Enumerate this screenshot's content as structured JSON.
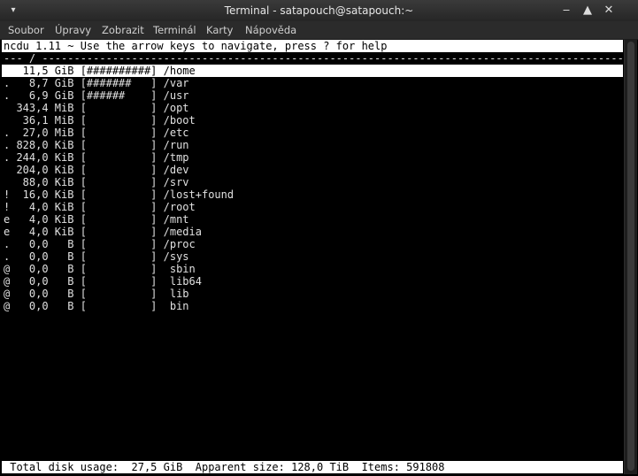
{
  "window": {
    "title": "Terminal - satapouch@satapouch:~",
    "menu_arrow": "▾",
    "minimize_glyph": "‒",
    "maximize_glyph": "▲",
    "close_glyph": "✕"
  },
  "menubar": {
    "items": [
      "Soubor",
      "Úpravy",
      "Zobrazit",
      "Terminál",
      "Karty",
      "Nápověda"
    ]
  },
  "terminal": {
    "header": "ncdu 1.11 ~ Use the arrow keys to navigate, press ? for help",
    "path_line": "--- / ---------------------------------------------------------------------------------------------",
    "entries": [
      {
        "text": "   11,5 GiB [##########] /home",
        "selected": true
      },
      {
        "text": ".   8,7 GiB [#######   ] /var"
      },
      {
        "text": ".   6,9 GiB [######    ] /usr"
      },
      {
        "text": "  343,4 MiB [          ] /opt"
      },
      {
        "text": "   36,1 MiB [          ] /boot"
      },
      {
        "text": ".  27,0 MiB [          ] /etc"
      },
      {
        "text": ". 828,0 KiB [          ] /run"
      },
      {
        "text": ". 244,0 KiB [          ] /tmp"
      },
      {
        "text": "  204,0 KiB [          ] /dev"
      },
      {
        "text": "   88,0 KiB [          ] /srv"
      },
      {
        "text": "!  16,0 KiB [          ] /lost+found"
      },
      {
        "text": "!   4,0 KiB [          ] /root"
      },
      {
        "text": "e   4,0 KiB [          ] /mnt"
      },
      {
        "text": "e   4,0 KiB [          ] /media"
      },
      {
        "text": ".   0,0   B [          ] /proc"
      },
      {
        "text": ".   0,0   B [          ] /sys"
      },
      {
        "text": "@   0,0   B [          ]  sbin"
      },
      {
        "text": "@   0,0   B [          ]  lib64"
      },
      {
        "text": "@   0,0   B [          ]  lib"
      },
      {
        "text": "@   0,0   B [          ]  bin"
      }
    ],
    "footer": " Total disk usage:  27,5 GiB  Apparent size: 128,0 TiB  Items: 591808"
  }
}
